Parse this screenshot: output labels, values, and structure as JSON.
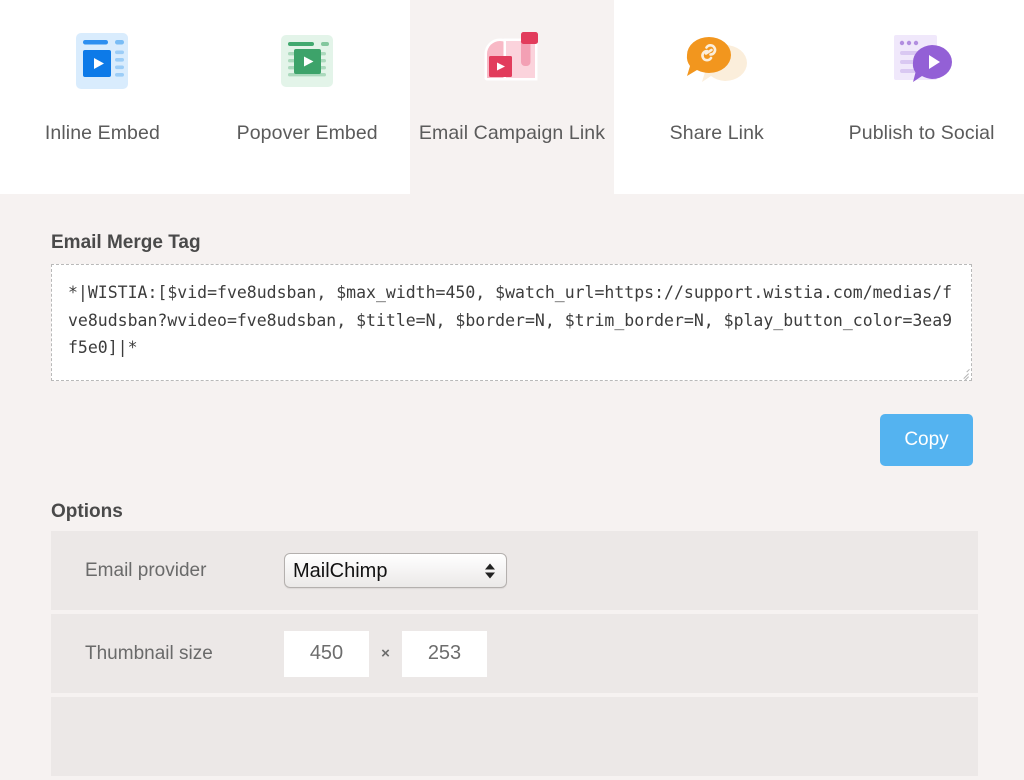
{
  "tabs": [
    {
      "id": "inline-embed",
      "label": "Inline Embed",
      "icon": "inline-embed-icon",
      "active": false
    },
    {
      "id": "popover-embed",
      "label": "Popover Embed",
      "icon": "popover-embed-icon",
      "active": false
    },
    {
      "id": "email-campaign-link",
      "label": "Email Campaign Link",
      "icon": "mailbox-video-icon",
      "active": true
    },
    {
      "id": "share-link",
      "label": "Share Link",
      "icon": "chat-bubble-link-icon",
      "active": false
    },
    {
      "id": "publish-to-social",
      "label": "Publish to Social",
      "icon": "social-post-video-icon",
      "active": false
    }
  ],
  "merge_tag": {
    "title": "Email Merge Tag",
    "value": "*|WISTIA:[$vid=fve8udsban, $max_width=450, $watch_url=https://support.wistia.com/medias/fve8udsban?wvideo=fve8udsban, $title=N, $border=N, $trim_border=N, $play_button_color=3ea9f5e0]|*",
    "copy_label": "Copy"
  },
  "options": {
    "title": "Options",
    "email_provider": {
      "label": "Email provider",
      "value": "MailChimp",
      "choices": [
        "MailChimp"
      ]
    },
    "thumbnail_size": {
      "label": "Thumbnail size",
      "width": "450",
      "separator": "×",
      "height": "253"
    }
  },
  "colors": {
    "page_background": "#f6f2f1",
    "tabbar_background": "#ffffff",
    "row_background": "#ece8e7",
    "copy_button": "#54b3f0",
    "inline_embed_accent": "#1a85e8",
    "popover_embed_accent": "#3da36a",
    "email_accent": "#e23c5c",
    "share_accent": "#f2961e",
    "social_accent": "#9360d6"
  }
}
